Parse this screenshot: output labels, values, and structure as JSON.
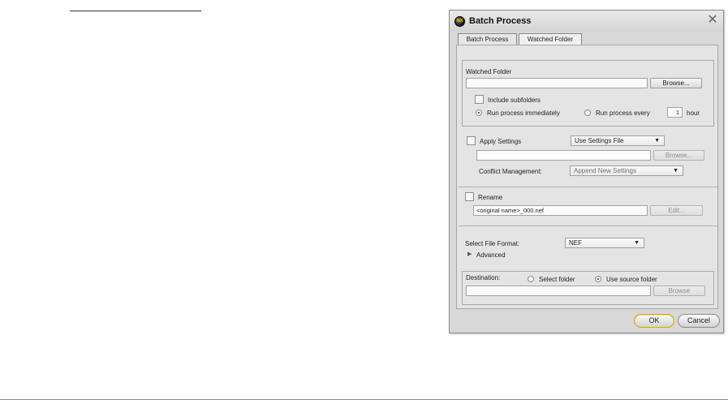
{
  "dialog": {
    "title": "Batch Process",
    "close_symbol": "✕",
    "app_icon_text": "NX"
  },
  "tabs": [
    {
      "label": "Batch Process",
      "active": false
    },
    {
      "label": "Watched Folder",
      "active": true
    }
  ],
  "watched_folder": {
    "label": "Watched Folder",
    "path_value": "",
    "browse_label": "Browse...",
    "include_subfolders_label": "Include subfolders",
    "include_subfolders_checked": false,
    "run_immediately_label": "Run process immediately",
    "run_every_label": "Run process every",
    "run_every_value": "1",
    "hour_label": "hour",
    "selected_run_option": "immediately"
  },
  "apply_settings": {
    "label": "Apply Settings",
    "checked": false,
    "mode_value": "Use Settings File",
    "file_value": "",
    "browse_label": "Browse...",
    "conflict_label": "Conflict Management:",
    "conflict_value": "Append New Settings"
  },
  "rename": {
    "label": "Rename",
    "checked": false,
    "pattern_value": "<original name>_000.nef",
    "edit_label": "Edit..."
  },
  "file_format": {
    "label": "Select File Format:",
    "value": "NEF",
    "advanced_label": "Advanced"
  },
  "destination": {
    "label": "Destination:",
    "select_folder_label": "Select folder",
    "use_source_label": "Use source folder",
    "selected": "use_source",
    "path_value": "",
    "browse_label": "Browse"
  },
  "footer": {
    "ok_label": "OK",
    "cancel_label": "Cancel"
  },
  "icons": {
    "dropdown_arrow": "▼",
    "disclosure": "▶"
  }
}
